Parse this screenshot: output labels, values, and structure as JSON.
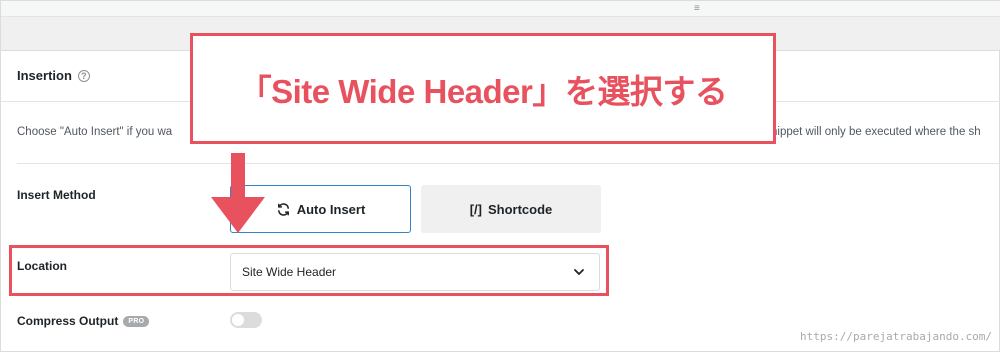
{
  "topbar": {
    "handle_glyph": "≡"
  },
  "insertion": {
    "title": "Insertion",
    "help_icon": "?"
  },
  "description": {
    "left": "Choose \"Auto Insert\" if you wa",
    "right": "nippet will only be executed where the sh"
  },
  "insert_method": {
    "label": "Insert Method",
    "auto_insert_label": "Auto Insert",
    "auto_insert_icon": "refresh-icon",
    "shortcode_glyph": "[/]",
    "shortcode_label": "Shortcode"
  },
  "location": {
    "label": "Location",
    "selected_value": "Site Wide Header"
  },
  "compress_output": {
    "label": "Compress Output",
    "badge": "PRO",
    "enabled": false
  },
  "annotation": {
    "callout_text": "「Site Wide Header」を選択する",
    "accent_color": "#e8525f"
  },
  "watermark": "https://parejatrabajando.com/"
}
